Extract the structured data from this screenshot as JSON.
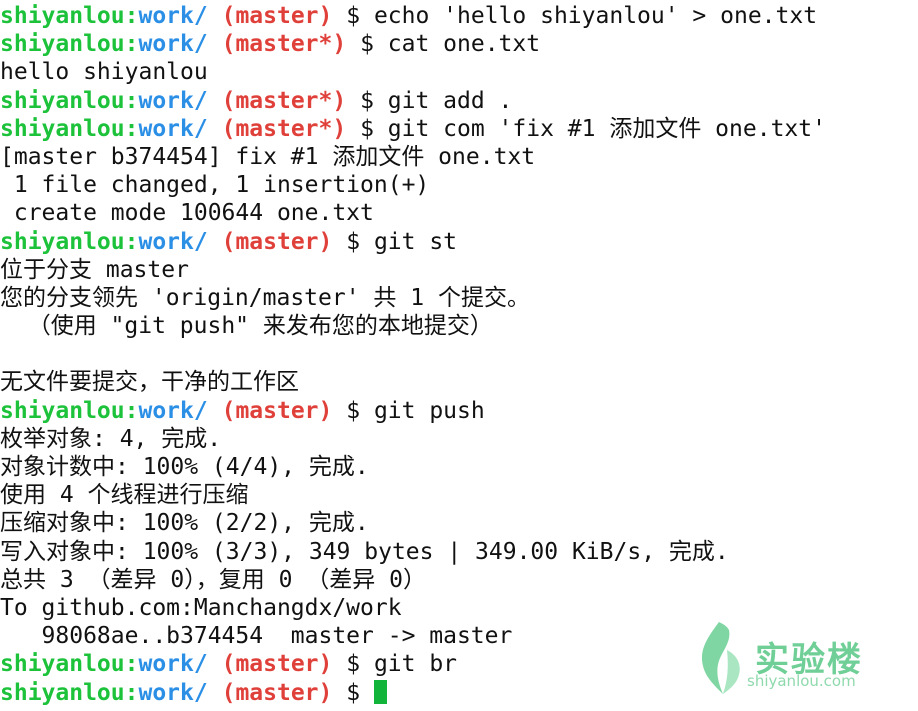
{
  "prompt": {
    "user": "shiyanlou",
    "sep": ":",
    "path": "work/",
    "branch_clean": "(master)",
    "branch_dirty": "(master*)",
    "dollar": "$"
  },
  "lines": [
    {
      "type": "prompt",
      "dirty": false,
      "cmd": " echo 'hello shiyanlou' > one.txt"
    },
    {
      "type": "prompt",
      "dirty": true,
      "cmd": " cat one.txt"
    },
    {
      "type": "out",
      "text": "hello shiyanlou"
    },
    {
      "type": "prompt",
      "dirty": true,
      "cmd": " git add ."
    },
    {
      "type": "prompt",
      "dirty": true,
      "cmd": " git com 'fix #1 添加文件 one.txt'"
    },
    {
      "type": "out",
      "text": "[master b374454] fix #1 添加文件 one.txt"
    },
    {
      "type": "out",
      "text": " 1 file changed, 1 insertion(+)"
    },
    {
      "type": "out",
      "text": " create mode 100644 one.txt"
    },
    {
      "type": "prompt",
      "dirty": false,
      "cmd": " git st"
    },
    {
      "type": "out",
      "text": "位于分支 master"
    },
    {
      "type": "out",
      "text": "您的分支领先 'origin/master' 共 1 个提交。"
    },
    {
      "type": "out",
      "text": "  （使用 \"git push\" 来发布您的本地提交）"
    },
    {
      "type": "out",
      "text": ""
    },
    {
      "type": "out",
      "text": "无文件要提交，干净的工作区"
    },
    {
      "type": "prompt",
      "dirty": false,
      "cmd": " git push"
    },
    {
      "type": "out",
      "text": "枚举对象: 4, 完成."
    },
    {
      "type": "out",
      "text": "对象计数中: 100% (4/4), 完成."
    },
    {
      "type": "out",
      "text": "使用 4 个线程进行压缩"
    },
    {
      "type": "out",
      "text": "压缩对象中: 100% (2/2), 完成."
    },
    {
      "type": "out",
      "text": "写入对象中: 100% (3/3), 349 bytes | 349.00 KiB/s, 完成."
    },
    {
      "type": "out",
      "text": "总共 3 （差异 0），复用 0 （差异 0）"
    },
    {
      "type": "out",
      "text": "To github.com:Manchangdx/work"
    },
    {
      "type": "out",
      "text": "   98068ae..b374454  master -> master"
    },
    {
      "type": "prompt",
      "dirty": false,
      "cmd": " git br"
    },
    {
      "type": "prompt",
      "dirty": false,
      "cmd": " ",
      "cursor": true
    }
  ],
  "watermark": {
    "title": "实验楼",
    "url": "shiyanlou.com",
    "color": "#6fcf97",
    "icon": "leaf-logo-icon"
  },
  "colors": {
    "user": "#1cc23a",
    "path": "#2b8fe6",
    "branch": "#e0403a",
    "cursor": "#12b53a"
  }
}
